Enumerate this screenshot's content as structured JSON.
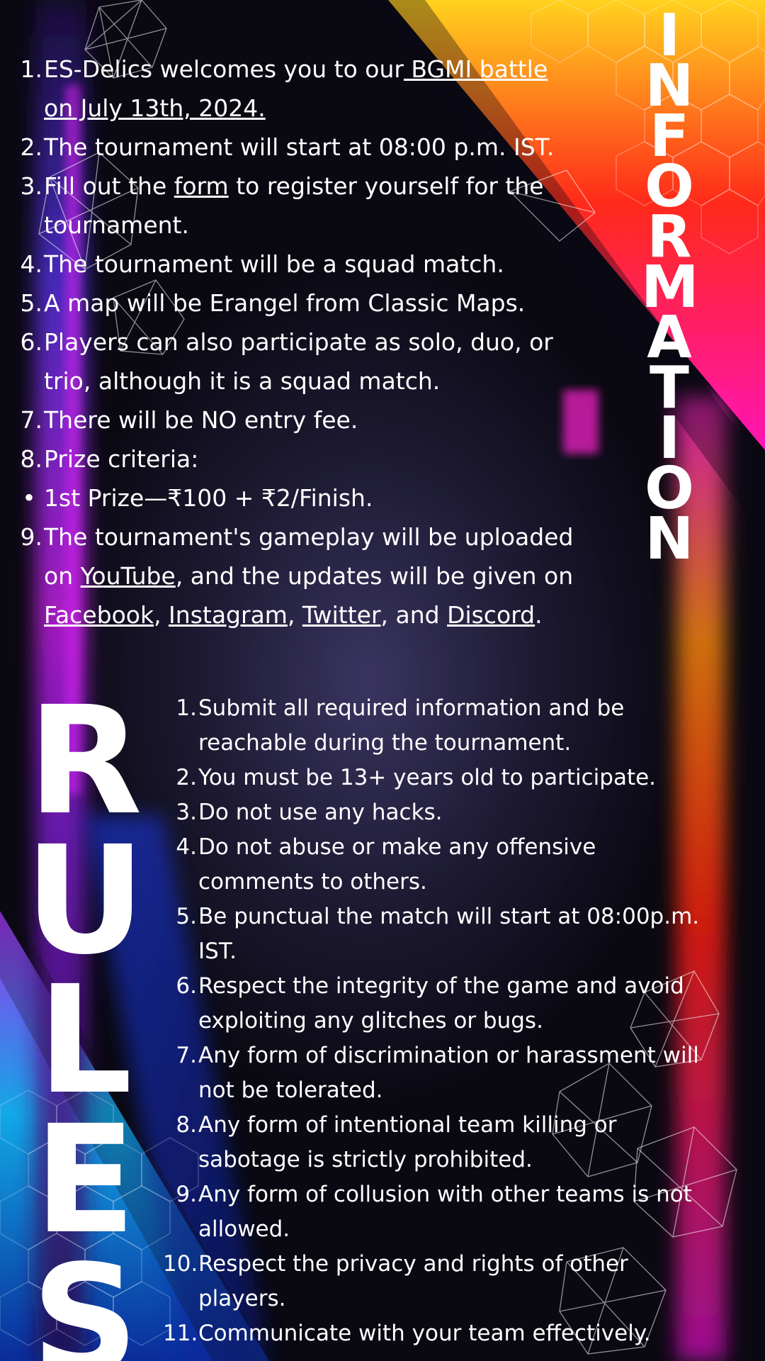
{
  "colors": {
    "background": "#0b0a14",
    "top_right_gradient": [
      "#ffd21e",
      "#ff2a1a",
      "#ff14b4"
    ],
    "bottom_left_gradient": [
      "#8a2be2",
      "#1aa0e0",
      "#0a2a8a"
    ],
    "text": "#ffffff"
  },
  "information": {
    "heading_letters": [
      "I",
      "N",
      "F",
      "O",
      "R",
      "M",
      "A",
      "T",
      "I",
      "O",
      "N"
    ],
    "items": [
      {
        "marker": "1.",
        "parts": [
          {
            "text": "ES-Delics welcomes you to our"
          },
          {
            "text": " BGMI battle on July 13th, 2024.",
            "link": true
          }
        ]
      },
      {
        "marker": "2.",
        "parts": [
          {
            "text": "The tournament will start at 08:00 p.m. IST."
          }
        ]
      },
      {
        "marker": "3.",
        "parts": [
          {
            "text": "Fill out the "
          },
          {
            "text": "form",
            "link": true
          },
          {
            "text": " to register yourself for the tournament."
          }
        ]
      },
      {
        "marker": "4.",
        "parts": [
          {
            "text": "The tournament will be a squad match."
          }
        ]
      },
      {
        "marker": "5.",
        "parts": [
          {
            "text": "A map will be Erangel from Classic Maps."
          }
        ]
      },
      {
        "marker": "6.",
        "parts": [
          {
            "text": "Players can also participate as solo, duo, or trio, although it is a squad match."
          }
        ]
      },
      {
        "marker": "7.",
        "parts": [
          {
            "text": "There will be NO entry fee."
          }
        ]
      },
      {
        "marker": "8.",
        "parts": [
          {
            "text": "Prize criteria:"
          }
        ]
      },
      {
        "marker": "•",
        "bullet": true,
        "parts": [
          {
            "text": "1st Prize—₹100 + ₹2/Finish."
          }
        ]
      },
      {
        "marker": "9.",
        "parts": [
          {
            "text": "The tournament's gameplay will be uploaded on "
          },
          {
            "text": "YouTube",
            "link": true
          },
          {
            "text": ", and the updates will be given on "
          },
          {
            "text": "Facebook",
            "link": true
          },
          {
            "text": ", "
          },
          {
            "text": "Instagram",
            "link": true
          },
          {
            "text": ", "
          },
          {
            "text": "Twitter",
            "link": true
          },
          {
            "text": ", and "
          },
          {
            "text": "Discord",
            "link": true
          },
          {
            "text": "."
          }
        ]
      }
    ]
  },
  "rules": {
    "heading_letters": [
      "R",
      "U",
      "L",
      "E",
      "S"
    ],
    "items": [
      {
        "marker": "1.",
        "text": "Submit all required information and be reachable during the tournament."
      },
      {
        "marker": "2.",
        "text": "You must be 13+ years old to participate."
      },
      {
        "marker": "3.",
        "text": "Do not use any hacks."
      },
      {
        "marker": "4.",
        "text": "Do not abuse or make any offensive comments to others."
      },
      {
        "marker": "5.",
        "text": "Be punctual the match will start at 08:00p.m. IST."
      },
      {
        "marker": "6.",
        "text": "Respect the integrity of the game and avoid exploiting any glitches or bugs."
      },
      {
        "marker": "7.",
        "text": "Any form of discrimination or harassment will not be tolerated."
      },
      {
        "marker": "8.",
        "text": "Any form of intentional team killing or sabotage is strictly prohibited."
      },
      {
        "marker": "9.",
        "text": "Any form of collusion with other teams is not allowed."
      },
      {
        "marker": "10.",
        "text": "Respect the privacy and rights of other players."
      },
      {
        "marker": "11.",
        "text": "Communicate with your team effectively."
      }
    ]
  }
}
